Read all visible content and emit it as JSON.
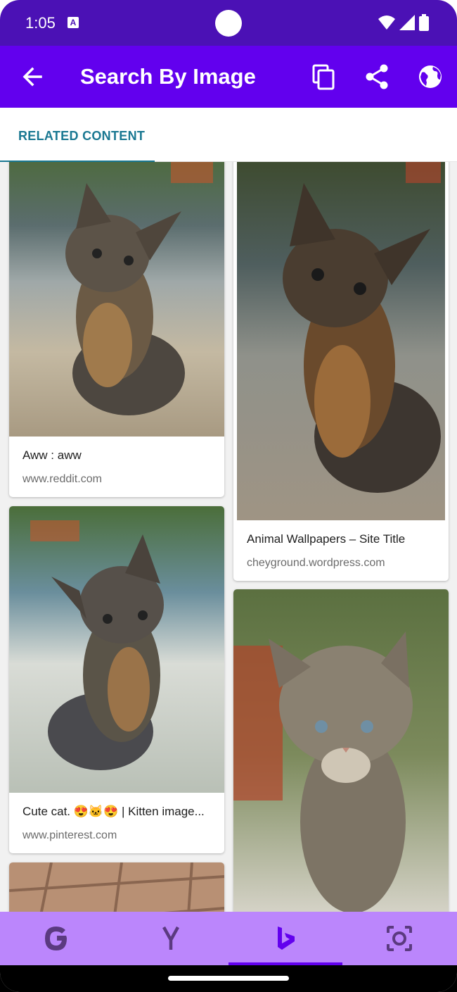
{
  "status_bar": {
    "time": "1:05",
    "notification_icon": "a-icon"
  },
  "app_bar": {
    "title": "Search By Image",
    "actions": [
      "copy-icon",
      "share-icon",
      "globe-icon"
    ],
    "color": "#6200ee"
  },
  "tabs": [
    {
      "label": "RELATED CONTENT",
      "selected": true
    }
  ],
  "results": [
    {
      "title": "Aww : aww",
      "source": "www.reddit.com"
    },
    {
      "title": "Animal Wallpapers – Site Title",
      "source": "cheyground.wordpress.com"
    },
    {
      "title": "Cute cat. 😍🐱😍 | Kitten image...",
      "source": "www.pinterest.com"
    },
    {
      "title": "",
      "source": ""
    },
    {
      "title": "",
      "source": ""
    }
  ],
  "bottom_nav": {
    "items": [
      "google-icon",
      "yandex-icon",
      "bing-icon",
      "lens-icon"
    ],
    "selected": "bing-icon",
    "color": "#bb86fc",
    "accent": "#6200ee"
  }
}
